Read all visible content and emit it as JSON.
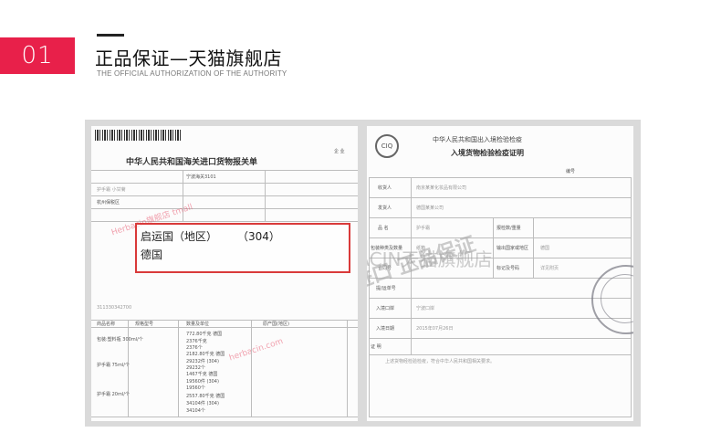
{
  "section": {
    "number": "01",
    "title": "正品保证—天猫旗舰店",
    "subtitle": "THE OFFICIAL AUTHORIZATION OF THE AUTHORITY"
  },
  "customs_declaration": {
    "title": "中华人民共和国海关进口货物报关单",
    "top_right": "企 业",
    "port": "宁波海关3101",
    "country_label": "启运国（地区）",
    "country_code": "（304）",
    "country_name": "德国",
    "remark": "杭州保税区",
    "watermark_red": "Herbacin旗舰店 tmall",
    "watermark_red2": "herbacin.com",
    "row_labels": [
      "商品名称",
      "规格型号",
      "数量及单位",
      "原产国(地区)"
    ],
    "row_values": [
      "772.80千克 德国",
      "2376千克",
      "2182.80千克 德国",
      "29232件 (304)",
      "1467千克 德国",
      "19560件 (304)",
      "2557.80千克 德国",
      "34104件 (304)"
    ],
    "numbers": [
      "311330342700",
      "2376个",
      "29232个",
      "19560个",
      "34104个"
    ],
    "goods_lines": [
      "护手霜 小甘菊",
      "包装:塑料瓶 300ml/个",
      "护手霜 75ml/个",
      "护手霜 20ml/个"
    ]
  },
  "inspection_certificate": {
    "title_line1": "中华人民共和国出入境检验检疫",
    "title_line2": "入境货物检验检疫证明",
    "number_label": "编号",
    "seal_label": "CIQ",
    "row_labels": [
      "收货人",
      "发货人",
      "品 名",
      "包装种类及数量",
      "合同号",
      "提/运单号",
      "入境口岸",
      "入境日期"
    ],
    "row_values": [
      "南京某某化妆品有限公司",
      "德国某某公司",
      "护手霜",
      "纸箱",
      "",
      "",
      "宁波口岸",
      "2015年07月26日"
    ],
    "right_labels": [
      "报检数/重量",
      "输出国家或地区",
      "标记及号码"
    ],
    "right_values": [
      "",
      "德国",
      "详见附页"
    ],
    "footer_label": "证 明",
    "footer_text": "上述货物经检验检疫，符合中华人民共和国相关要求。",
    "watermark": "HERBACIN天猫旗舰店",
    "watermark_big": "德国进口 正品保证"
  }
}
